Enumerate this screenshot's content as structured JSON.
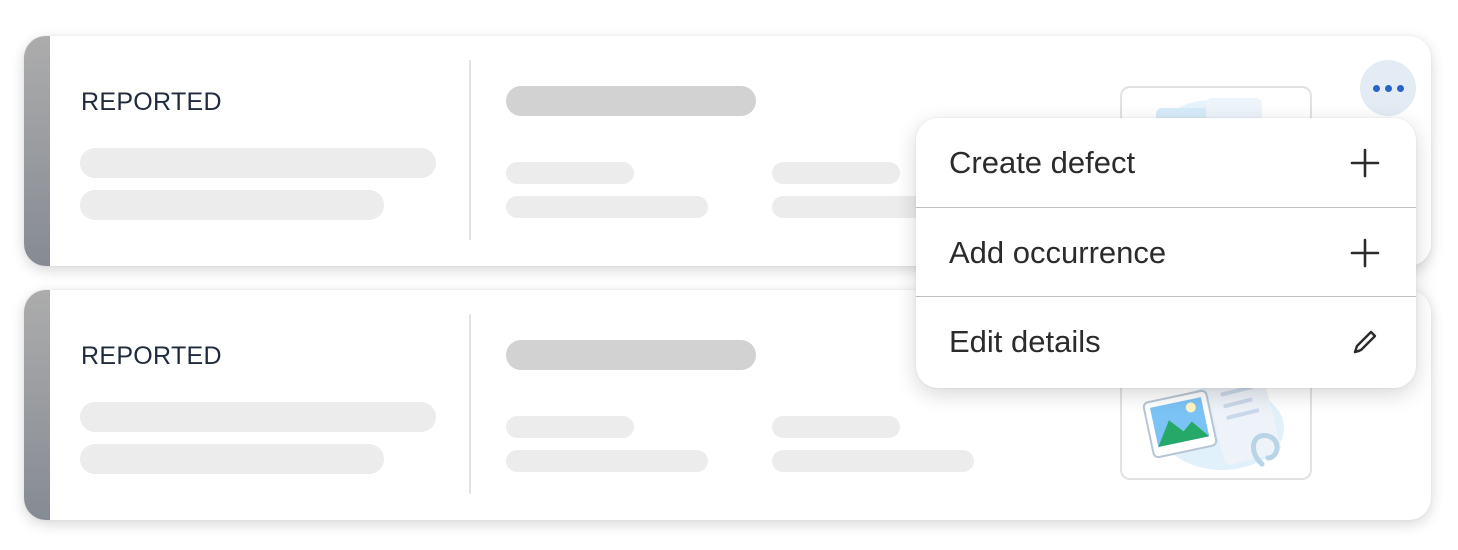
{
  "cards": [
    {
      "status": "REPORTED"
    },
    {
      "status": "REPORTED"
    }
  ],
  "more_button": {
    "icon": "more-horizontal-icon",
    "accent": "#2a62c8"
  },
  "menu": {
    "items": [
      {
        "label": "Create defect",
        "icon": "plus-icon"
      },
      {
        "label": "Add occurrence",
        "icon": "plus-icon"
      },
      {
        "label": "Edit details",
        "icon": "pencil-icon"
      }
    ]
  },
  "colors": {
    "status_text": "#1f2a3d",
    "stripe": "#868b93",
    "menu_text": "#2b2b2b"
  }
}
